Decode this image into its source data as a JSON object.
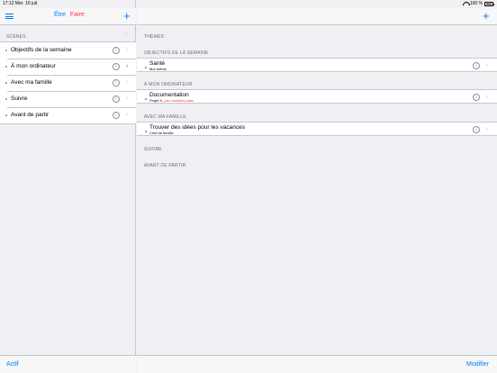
{
  "status_bar": {
    "time_date": "17:12  Mer. 10 juil.",
    "battery": "100 %"
  },
  "left": {
    "nav": {
      "segment_etre": "Être",
      "segment_faire": "Faire",
      "add_symbol": "+"
    },
    "section_header": "SCÈNES",
    "scenes": [
      {
        "label": "Objectifs de la semaine"
      },
      {
        "label": "À mon ordinateur"
      },
      {
        "label": "Avec ma famille"
      },
      {
        "label": "Suivre"
      },
      {
        "label": "Avant de partir"
      }
    ],
    "toolbar": {
      "actif_label": "Actif"
    }
  },
  "right": {
    "nav": {
      "add_symbol": "+"
    },
    "themes_header": "THÈMES",
    "sections": [
      {
        "header": "OBJECTIFS DE LA SEMAINE",
        "items": [
          {
            "title": "Santé",
            "subtitle": "Moi-même",
            "subtitle_warn": ""
          }
        ]
      },
      {
        "header": "À MON ORDINATEUR",
        "items": [
          {
            "title": "Documentation",
            "subtitle": "Projet X,",
            "subtitle_warn": "par omnifield.pass"
          }
        ]
      },
      {
        "header": "AVEC MA FAMILLE",
        "items": [
          {
            "title": "Trouver des idées pour les vacances",
            "subtitle": "Chef de famille",
            "subtitle_warn": ""
          }
        ]
      },
      {
        "header": "SUIVRE",
        "items": []
      },
      {
        "header": "AVANT DE PARTIR",
        "items": []
      }
    ],
    "toolbar": {
      "modifier_label": "Modifier"
    }
  },
  "icons": {
    "menu": "hamburger-icon",
    "info": "info-icon",
    "chevron": "chevron-right-icon",
    "wifi": "wifi-icon",
    "battery": "battery-icon"
  },
  "colors": {
    "accent": "#007aff",
    "faire": "#ff2d55",
    "warning": "#ff3b30",
    "background": "#efeff4"
  }
}
